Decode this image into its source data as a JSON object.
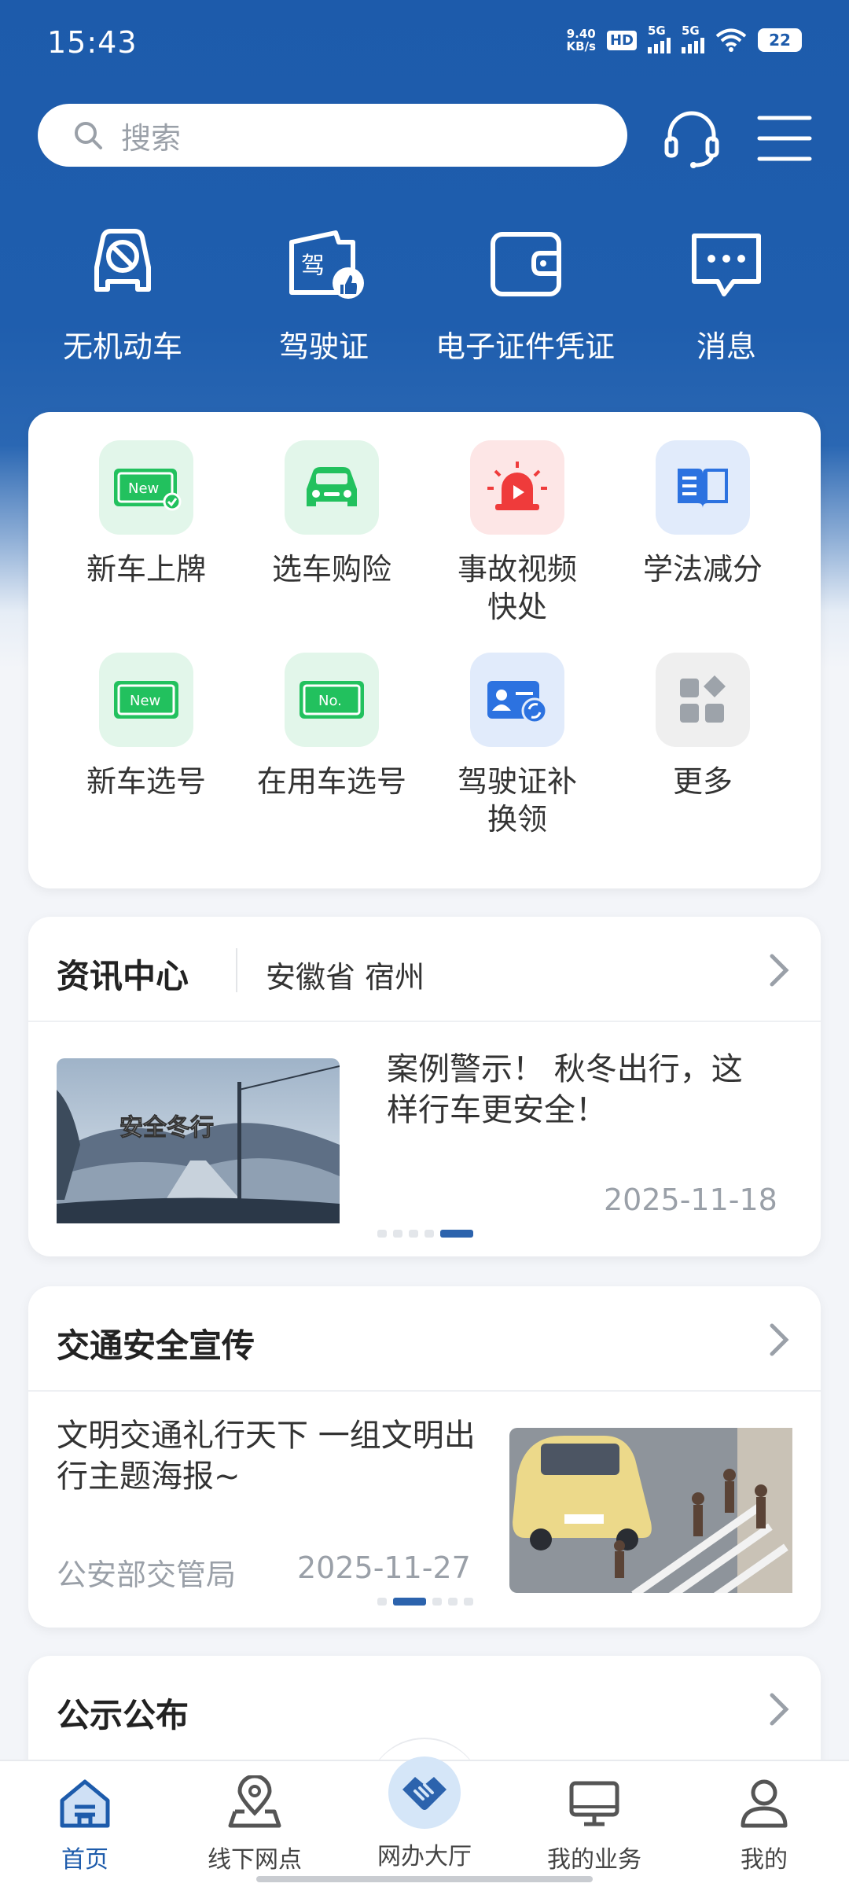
{
  "status_bar": {
    "time": "15:43",
    "speed_value": "9.40",
    "speed_unit": "KB/s",
    "hd": "HD",
    "net1": "5G",
    "net2": "5G",
    "battery": "22"
  },
  "search": {
    "placeholder": "搜索"
  },
  "header_icons": [
    "headset-icon",
    "menu-icon"
  ],
  "quick_links": [
    {
      "label": "无机动车",
      "icon": "no-car-icon"
    },
    {
      "label": "驾驶证",
      "icon": "license-icon",
      "badge": "驾"
    },
    {
      "label": "电子证件凭证",
      "icon": "wallet-icon"
    },
    {
      "label": "消息",
      "icon": "message-icon"
    }
  ],
  "services": [
    {
      "label": "新车上牌",
      "icon": "new-plate-icon",
      "tile_text": "New"
    },
    {
      "label": "选车购险",
      "icon": "car-insurance-icon"
    },
    {
      "label": "事故视频快处",
      "icon": "siren-icon"
    },
    {
      "label": "学法减分",
      "icon": "book-icon"
    },
    {
      "label": "新车选号",
      "icon": "new-number-icon",
      "tile_text": "New"
    },
    {
      "label": "在用车选号",
      "icon": "number-plate-icon",
      "tile_text": "No."
    },
    {
      "label": "驾驶证补换领",
      "icon": "license-renew-icon"
    },
    {
      "label": "更多",
      "icon": "more-icon"
    }
  ],
  "news_center": {
    "title": "资讯中心",
    "region": "安徽省 宿州",
    "item": {
      "title": "案例警示！ 秋冬出行，这样行车更安全！",
      "date": "2025-11-18",
      "image_caption": "安全冬行"
    }
  },
  "safety": {
    "title": "交通安全宣传",
    "item": {
      "title": "文明交通礼行天下 一组文明出行主题海报~",
      "source": "公安部交管局",
      "date": "2025-11-27"
    }
  },
  "notice": {
    "title": "公示公布"
  },
  "bottom_nav": [
    {
      "label": "首页",
      "icon": "home-icon"
    },
    {
      "label": "线下网点",
      "icon": "location-icon"
    },
    {
      "label": "网办大厅",
      "icon": "handshake-icon"
    },
    {
      "label": "我的业务",
      "icon": "monitor-icon"
    },
    {
      "label": "我的",
      "icon": "user-icon"
    }
  ],
  "colors": {
    "primary": "#1d5bab",
    "green": "#22c15e",
    "red": "#ef3b3b",
    "blue": "#2c72e0"
  }
}
